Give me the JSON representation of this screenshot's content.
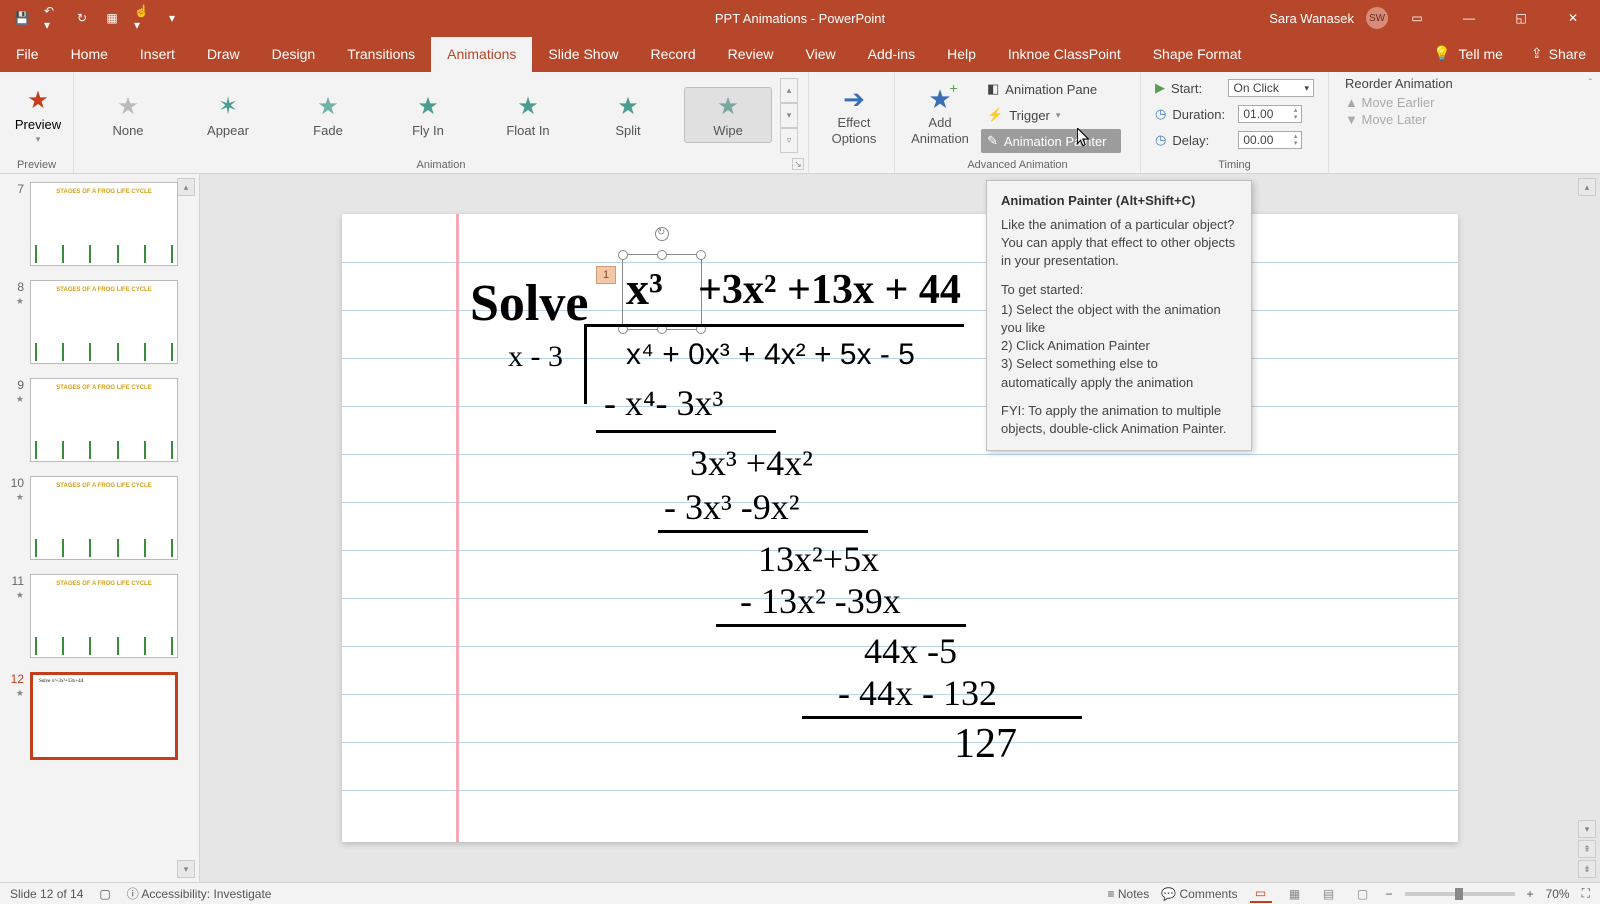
{
  "titlebar": {
    "title": "PPT Animations  -  PowerPoint",
    "user": "Sara Wanasek",
    "initials": "SW"
  },
  "tabs": {
    "items": [
      "File",
      "Home",
      "Insert",
      "Draw",
      "Design",
      "Transitions",
      "Animations",
      "Slide Show",
      "Record",
      "Review",
      "View",
      "Add-ins",
      "Help",
      "Inknoe ClassPoint",
      "Shape Format"
    ],
    "active": "Animations",
    "tellme": "Tell me",
    "share": "Share"
  },
  "ribbon": {
    "preview": "Preview",
    "preview_group": "Preview",
    "gallery": [
      "None",
      "Appear",
      "Fade",
      "Fly In",
      "Float In",
      "Split",
      "Wipe"
    ],
    "gallery_active": "Wipe",
    "animation_group": "Animation",
    "effect_options": "Effect\nOptions",
    "add_animation": "Add\nAnimation",
    "animation_pane": "Animation Pane",
    "trigger": "Trigger",
    "animation_painter": "Animation Painter",
    "advanced_group": "Advanced Animation",
    "start_lbl": "Start:",
    "start_val": "On Click",
    "duration_lbl": "Duration:",
    "duration_val": "01.00",
    "delay_lbl": "Delay:",
    "delay_val": "00.00",
    "timing_group": "Timing",
    "reorder_title": "Reorder Animation",
    "move_earlier": "Move Earlier",
    "move_later": "Move Later"
  },
  "thumbs": [
    {
      "num": "7",
      "star": false
    },
    {
      "num": "8",
      "star": true
    },
    {
      "num": "9",
      "star": true
    },
    {
      "num": "10",
      "star": true
    },
    {
      "num": "11",
      "star": true
    },
    {
      "num": "12",
      "star": true,
      "selected": true
    }
  ],
  "slide": {
    "solve": "Solve",
    "tag": "1",
    "l_quotient_seg1": "x³",
    "l_quotient_seg2": "+3x² +13x + 44",
    "l_divisor": "x - 3",
    "l_dividend": "x⁴ + 0x³ + 4x² + 5x - 5",
    "l2": "- x⁴- 3x³",
    "l3": "3x³ +4x²",
    "l4": "- 3x³ -9x²",
    "l5": "13x²+5x",
    "l6": "- 13x² -39x",
    "l7": "44x  -5",
    "l8": "- 44x - 132",
    "l9": "127"
  },
  "tooltip": {
    "title": "Animation Painter (Alt+Shift+C)",
    "body": "Like the animation of a particular object? You can apply that effect to other objects in your presentation.",
    "started": "To get started:",
    "s1": "1) Select the object with the animation you like",
    "s2": "2) Click Animation Painter",
    "s3": "3) Select something else to automatically apply the animation",
    "fyi": "FYI: To apply the animation to multiple objects, double-click Animation Painter."
  },
  "status": {
    "slide": "Slide 12 of 14",
    "access": "Accessibility: Investigate",
    "notes": "Notes",
    "comments": "Comments",
    "zoom": "70%"
  }
}
